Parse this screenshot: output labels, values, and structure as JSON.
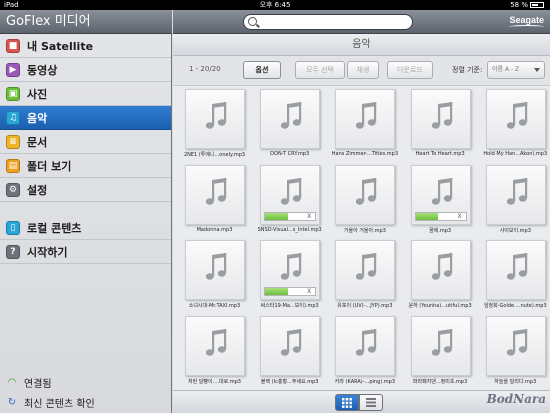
{
  "status": {
    "device": "iPad",
    "time": "오후 6:45",
    "battery": "58 %"
  },
  "app": {
    "title": "GoFlex 미디어",
    "brand": "Seagate"
  },
  "sidebar": {
    "items": [
      {
        "label": "내 Satellite",
        "icon": "satellite-icon",
        "color": "#d9534f"
      },
      {
        "label": "동영상",
        "icon": "video-icon",
        "color": "#9b59b6"
      },
      {
        "label": "사진",
        "icon": "photo-icon",
        "color": "#6abf3b"
      },
      {
        "label": "음악",
        "icon": "music-icon",
        "color": "#29a6d8",
        "selected": true
      },
      {
        "label": "문서",
        "icon": "document-icon",
        "color": "#f0b429"
      },
      {
        "label": "폴더 보기",
        "icon": "folder-icon",
        "color": "#f0a020"
      },
      {
        "label": "설정",
        "icon": "gear-icon",
        "color": "#6e737b"
      },
      {
        "label": "로컬 콘텐츠",
        "icon": "local-content-icon",
        "color": "#29a6d8"
      },
      {
        "label": "시작하기",
        "icon": "help-icon",
        "color": "#6e737b"
      }
    ],
    "status_label": "연결됨",
    "refresh_label": "최신 콘텐츠 확인"
  },
  "main": {
    "section_title": "음악",
    "count": "1 - 20/20",
    "buttons": {
      "options": "옵션",
      "select_all": "모두 선택",
      "play": "재생",
      "download": "다운로드"
    },
    "sort_label": "정렬 기준:",
    "sort_value": "이름 A - Z",
    "files": [
      {
        "name": "2NE1 (투에니...onely.mp3"
      },
      {
        "name": "DON-T CRY.mp3"
      },
      {
        "name": "Hans Zimmer-...Titles.mp3"
      },
      {
        "name": "Heart To Heart.mp3"
      },
      {
        "name": "Hold My Han...Akon).mp3"
      },
      {
        "name": "Madonna.mp3"
      },
      {
        "name": "SNSD-Visual...s_Intel.mp3",
        "progress": 0.45
      },
      {
        "name": "거울아 거울아.mp3"
      },
      {
        "name": "꿈에.mp3",
        "progress": 0.45
      },
      {
        "name": "사이보이.mp3"
      },
      {
        "name": "소녀시대-Mr.TAXI.mp3"
      },
      {
        "name": "써스타19-Ma...보이).mp3",
        "progress": 0.45
      },
      {
        "name": "유포이 (UV)-...JYP).mp3"
      },
      {
        "name": "윤하 (Younha)...utiful.mp3"
      },
      {
        "name": "임정희-Golde....nute).mp3"
      },
      {
        "name": "저런 달빵이....대로.mp3"
      },
      {
        "name": "블랙 (Ic홍황...주세요.mp3"
      },
      {
        "name": "카라 (KARA)-...ping).mp3"
      },
      {
        "name": "파라패지댄...정미초.mp3"
      },
      {
        "name": "하늘을 달리다.mp3"
      }
    ],
    "cancel_glyph": "X"
  },
  "watermark": "BodNara"
}
